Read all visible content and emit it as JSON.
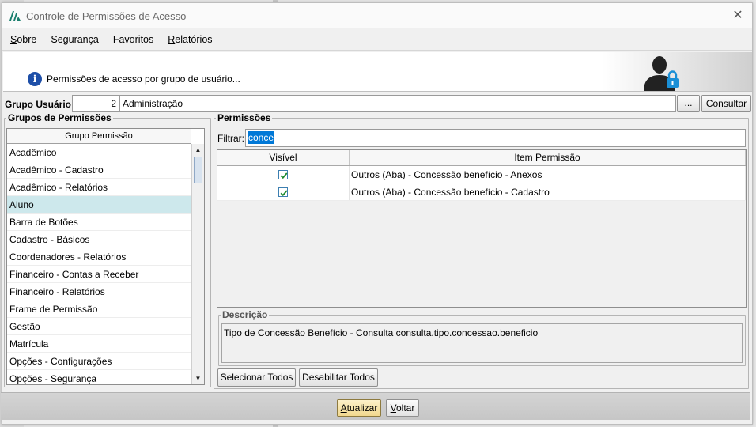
{
  "window": {
    "title": "Controle de Permissões de Acesso",
    "close_glyph": "✕"
  },
  "menu": [
    {
      "pre": "",
      "u": "S",
      "post": "obre"
    },
    {
      "pre": "Segurança",
      "u": "",
      "post": ""
    },
    {
      "pre": "Favoritos",
      "u": "",
      "post": ""
    },
    {
      "pre": "",
      "u": "R",
      "post": "elatórios"
    }
  ],
  "banner": {
    "info_icon": "i",
    "text": "Permissões de acesso por grupo de usuário..."
  },
  "group": {
    "label": "Grupo Usuário:",
    "code": "2",
    "name": "Administração",
    "dots_label": "...",
    "consultar_label": "Consultar"
  },
  "left_panel": {
    "legend": "Grupos de Permissões",
    "header": "Grupo Permissão",
    "selected_index": 3,
    "items": [
      "Acadêmico",
      "Acadêmico - Cadastro",
      "Acadêmico - Relatórios",
      "Aluno",
      "Barra de Botões",
      "Cadastro - Básicos",
      "Coordenadores - Relatórios",
      "Financeiro - Contas a Receber",
      "Financeiro - Relatórios",
      "Frame de Permissão",
      "Gestão",
      "Matrícula",
      "Opções - Configurações",
      "Opções - Segurança"
    ]
  },
  "right_panel": {
    "legend": "Permissões",
    "filter_label": "Filtrar:",
    "filter_value": "conce",
    "col_visible": "Visível",
    "col_item": "Item Permissão",
    "rows": [
      {
        "visible": true,
        "item": "Outros (Aba) - Concessão benefício - Anexos"
      },
      {
        "visible": true,
        "item": "Outros (Aba) - Concessão benefício - Cadastro"
      }
    ],
    "desc_legend": "Descrição",
    "desc_text": "Tipo de Concessão Benefício - Consulta consulta.tipo.concessao.beneficio",
    "select_all_label": "Selecionar Todos",
    "disable_all_label": "Desabilitar Todos"
  },
  "footer": {
    "atualizar": {
      "u": "A",
      "rest": "tualizar"
    },
    "voltar": {
      "u": "V",
      "rest": "oltar"
    }
  },
  "colors": {
    "selected_row": "#cde8ec",
    "accent_blue": "#0078d7",
    "primary_button": "#f1d88e"
  }
}
